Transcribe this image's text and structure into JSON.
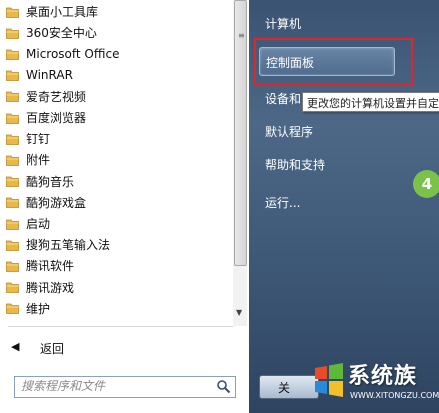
{
  "programs": [
    {
      "label": "桌面小工具库"
    },
    {
      "label": "360安全中心"
    },
    {
      "label": "Microsoft Office"
    },
    {
      "label": "WinRAR"
    },
    {
      "label": "爱奇艺视频"
    },
    {
      "label": "百度浏览器"
    },
    {
      "label": "钉钉"
    },
    {
      "label": "附件"
    },
    {
      "label": "酷狗音乐"
    },
    {
      "label": "酷狗游戏盒"
    },
    {
      "label": "启动"
    },
    {
      "label": "搜狗五笔输入法"
    },
    {
      "label": "腾讯软件"
    },
    {
      "label": "腾讯游戏"
    },
    {
      "label": "维护"
    }
  ],
  "back": {
    "label": "返回"
  },
  "search": {
    "placeholder": "搜索程序和文件"
  },
  "right_menu": {
    "computer": "计算机",
    "control_panel": "控制面板",
    "devices": "设备和",
    "default_programs": "默认程序",
    "help": "帮助和支持",
    "run": "运行..."
  },
  "tooltip": {
    "text": "更改您的计算机设置并自定"
  },
  "step_badge": {
    "text": "4"
  },
  "shutdown": {
    "label": "关"
  },
  "watermark": {
    "title": "系统族",
    "url": "WWW.XITONGZU.COM"
  },
  "icons": {
    "folder": "folder-icon",
    "search": "search-icon",
    "back": "back-arrow-icon",
    "logo": "windows-logo-icon"
  },
  "colors": {
    "highlight_box": "#e0262a",
    "right_panel": "#4d6886",
    "badge": "#7bc24a",
    "folder": "#e9b84a"
  }
}
